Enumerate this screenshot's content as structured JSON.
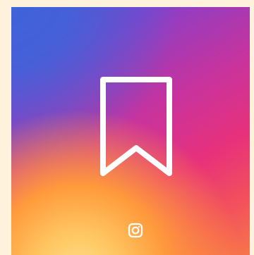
{
  "tile": {
    "icon": "bookmark-icon",
    "brand_icon": "instagram-logo-icon"
  },
  "colors": {
    "background": "#fff2dc",
    "gradient_blue": "#3f63d9",
    "gradient_purple": "#8a3fc7",
    "gradient_magenta": "#c8339d",
    "gradient_pink": "#e8317b",
    "gradient_orange": "#ff9a3c",
    "gradient_yellow": "#ffe08a",
    "icon_stroke": "#ffffff"
  }
}
